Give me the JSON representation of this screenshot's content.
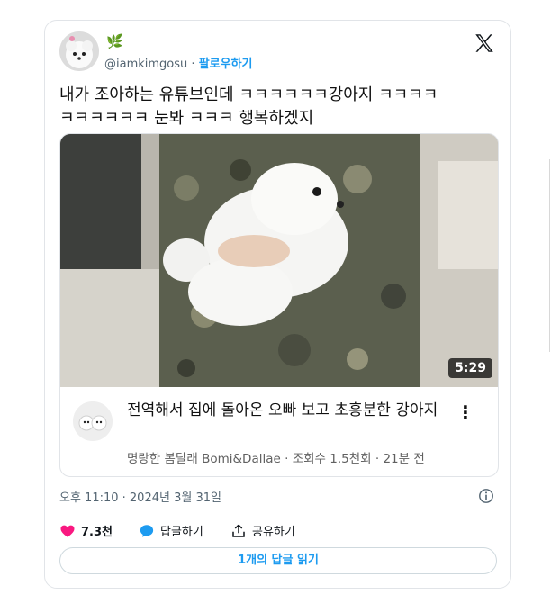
{
  "tweet": {
    "handle": "@iamkimgosu",
    "separator": "·",
    "follow_label": "팔로우하기",
    "text_line1": "내가 조아하는 유튜브인데 ㅋㅋㅋㅋㅋㅋ강아지 ㅋㅋㅋㅋ",
    "text_line2": "ㅋㅋㅋㅋㅋㅋ 눈봐 ㅋㅋㅋ 행복하겠지",
    "timestamp": "오후 11:10 · 2024년 3월 31일"
  },
  "video": {
    "duration": "5:29",
    "title": "전역해서 집에 돌아온 오빠 보고 초흥분한 강아지",
    "channel": "명랑한 봄달래 Bomi&Dallae",
    "meta": "조회수 1.5천회 · 21분 전",
    "separator": "·"
  },
  "actions": {
    "likes": "7.3천",
    "reply_label": "답글하기",
    "share_label": "공유하기"
  },
  "read_replies_label": "1개의 답글 읽기",
  "colors": {
    "accent": "#1d9bf0",
    "like": "#f91880",
    "text": "#0f1419",
    "muted": "#536471"
  }
}
